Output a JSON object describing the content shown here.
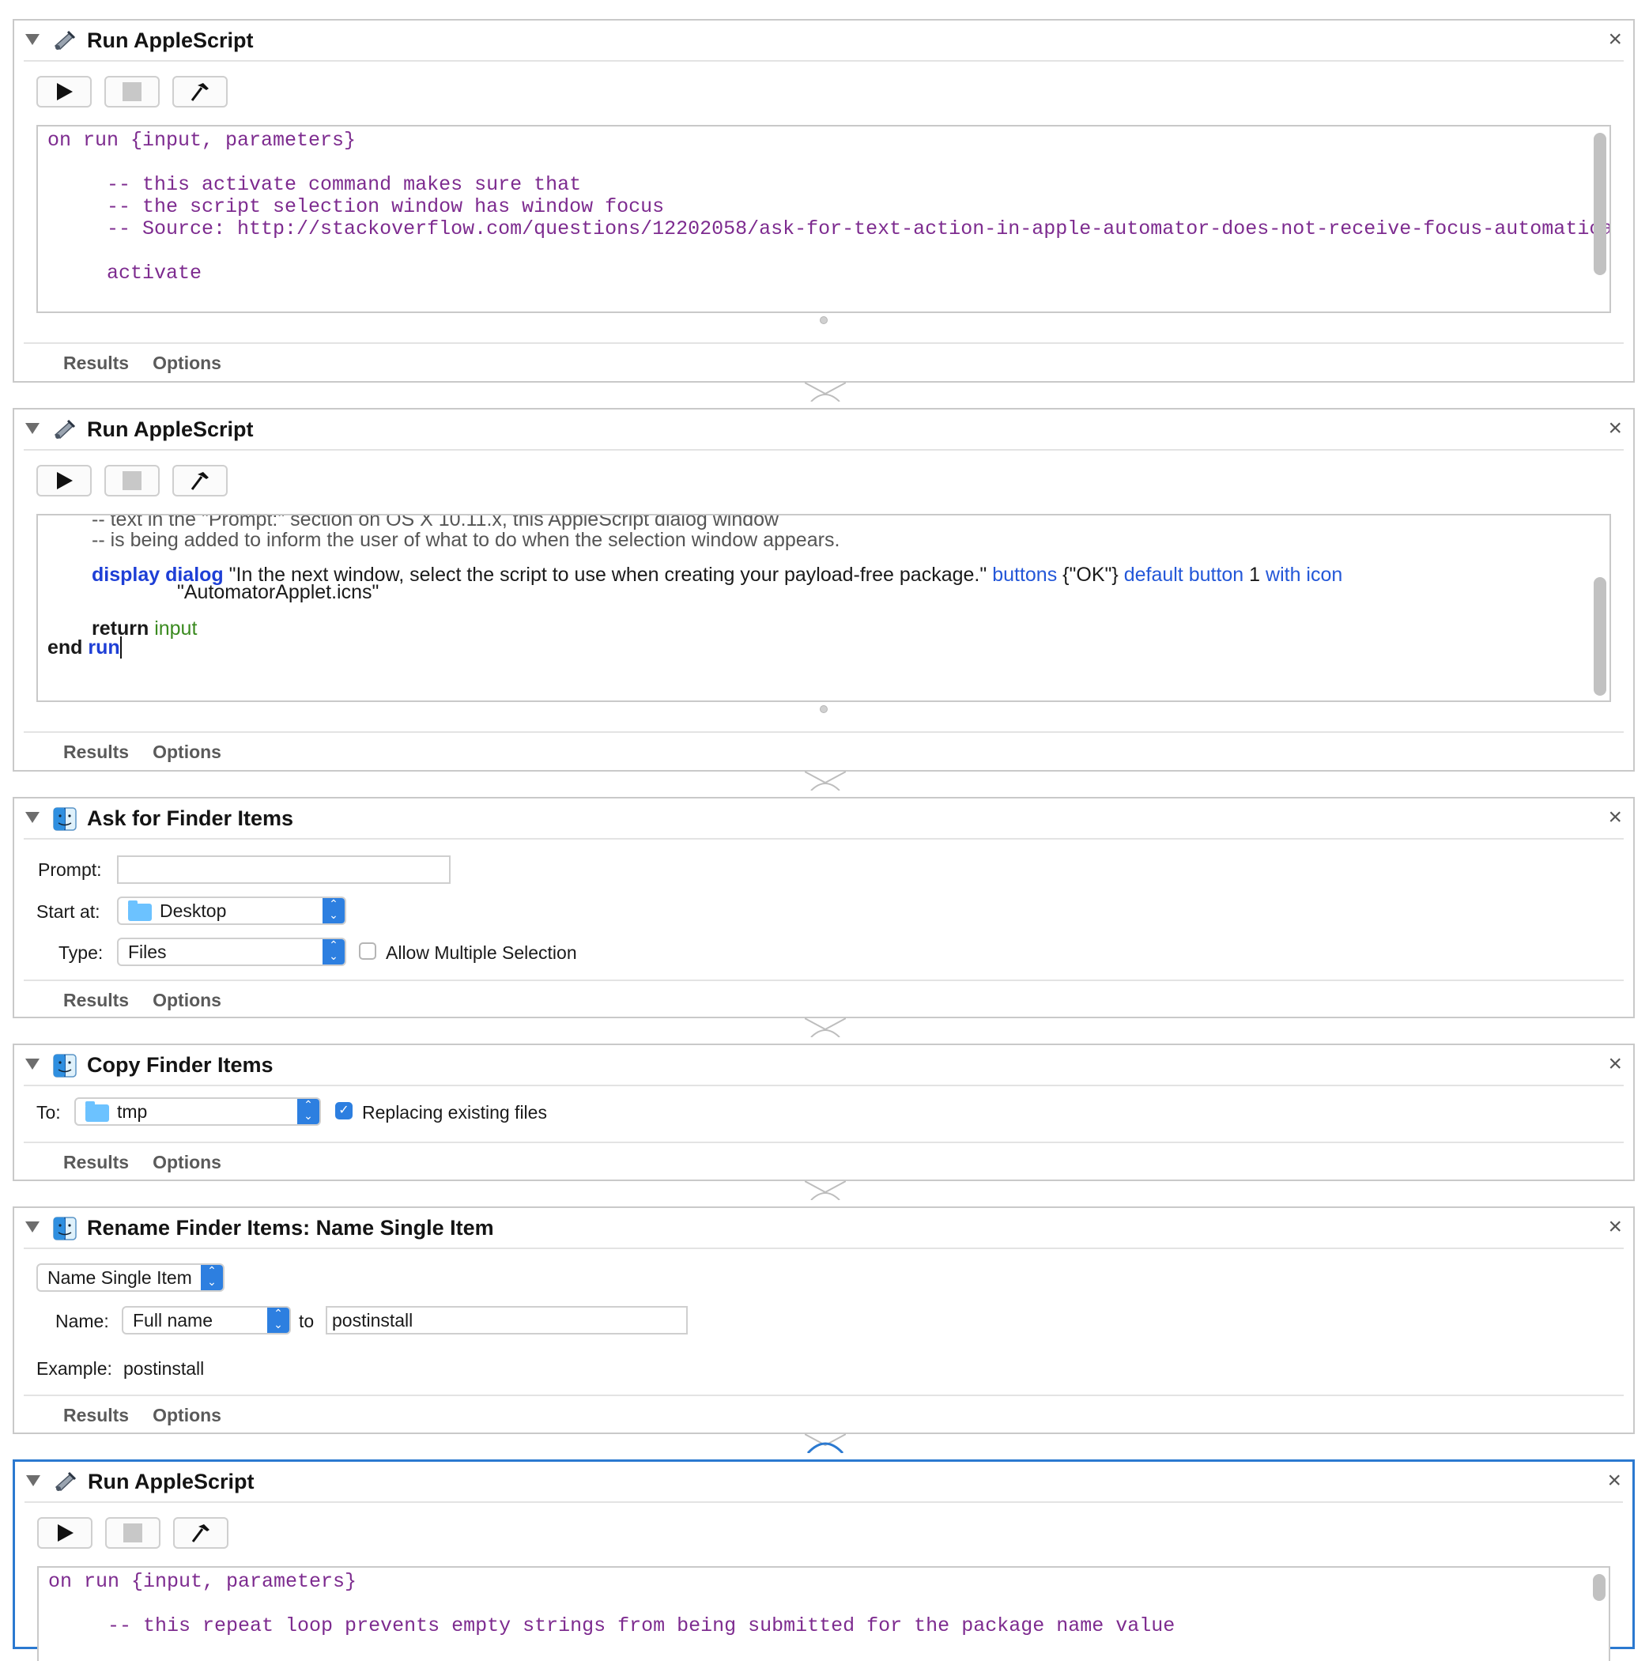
{
  "actions": [
    {
      "title": "Run AppleScript",
      "code": "on run {input, parameters}\n\n     -- this activate command makes sure that\n     -- the script selection window has window focus\n     -- Source: http://stackoverflow.com/questions/12202058/ask-for-text-action-in-apple-automator-does-not-receive-focus-automatically\n\n     activate",
      "tabs": [
        "Results",
        "Options"
      ]
    },
    {
      "title": "Run AppleScript",
      "code": {
        "comment1": "-- text in the \"Prompt:\" section on OS X 10.11.x, this AppleScript dialog window",
        "comment2": "-- is being added to inform the user of what to do when the selection window appears.",
        "kw_display": "display dialog",
        "str_message": "\"In the next window, select the script to use when creating your payload-free package.\"",
        "kw_buttons": "buttons",
        "str_ok": "{\"OK\"}",
        "kw_default": "default button",
        "num_one": "1",
        "kw_with_icon": "with icon",
        "str_icon": "\"AutomatorApplet.icns\"",
        "kw_return": "return",
        "var_input": "input",
        "kw_end": "end",
        "kw_run": "run"
      },
      "tabs": [
        "Results",
        "Options"
      ]
    },
    {
      "title": "Ask for Finder Items",
      "prompt_label": "Prompt:",
      "prompt_value": "",
      "start_label": "Start at:",
      "start_value": "Desktop",
      "type_label": "Type:",
      "type_value": "Files",
      "multi_label": "Allow Multiple Selection",
      "multi_checked": false,
      "tabs": [
        "Results",
        "Options"
      ]
    },
    {
      "title": "Copy Finder Items",
      "to_label": "To:",
      "to_value": "tmp",
      "replace_label": "Replacing existing files",
      "replace_checked": true,
      "tabs": [
        "Results",
        "Options"
      ]
    },
    {
      "title": "Rename Finder Items: Name Single Item",
      "mode_value": "Name Single Item",
      "name_label": "Name:",
      "name_value": "Full name",
      "to_label": "to",
      "to_value": "postinstall",
      "example_label": "Example:",
      "example_value": "postinstall",
      "tabs": [
        "Results",
        "Options"
      ]
    },
    {
      "title": "Run AppleScript",
      "code": "on run {input, parameters}\n\n     -- this repeat loop prevents empty strings from being submitted for the package name value"
    }
  ],
  "icons": {
    "collapse": "disclosure-triangle-icon",
    "script": "script-icon",
    "finder": "finder-icon",
    "close": "close-icon",
    "run": "play-icon",
    "stop": "stop-icon",
    "compile": "hammer-icon"
  },
  "colors": {
    "selected_border": "#2b79d0",
    "code_comment": "#7d2b8f",
    "keyword_blue": "#1e3fd6",
    "param_blue": "#2357d8",
    "var_green": "#3a8a1f"
  },
  "close_glyph": "×"
}
